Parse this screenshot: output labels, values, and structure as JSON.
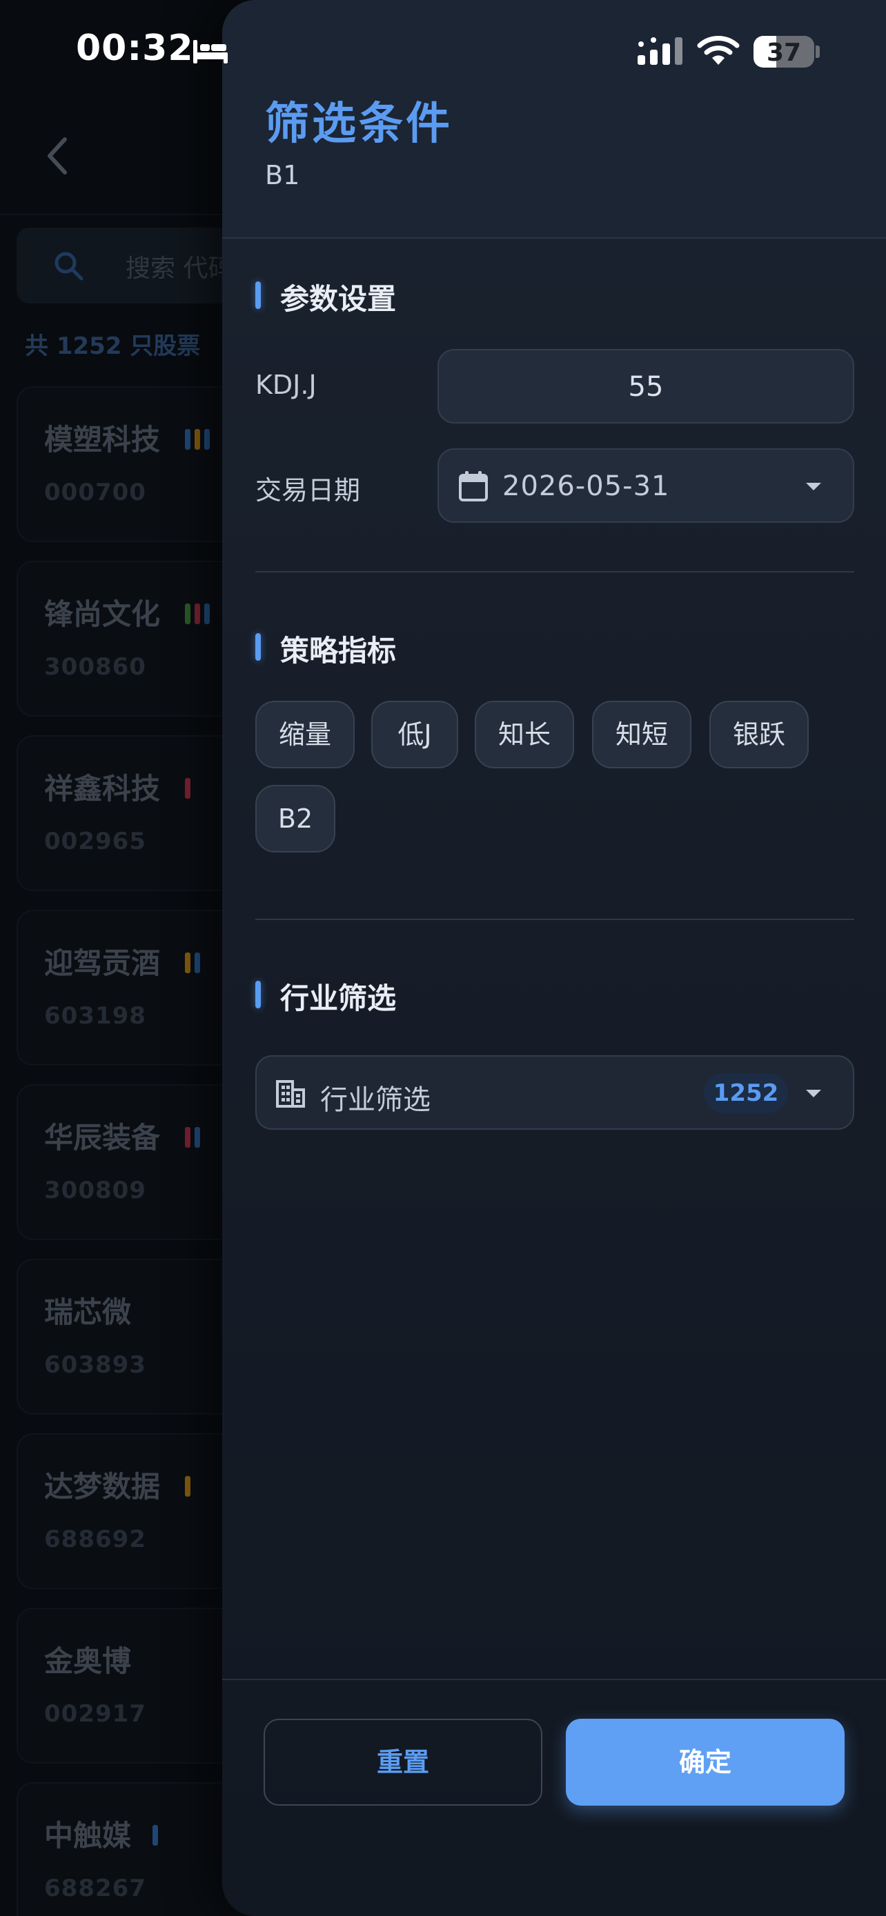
{
  "status_bar": {
    "time": "00:32",
    "battery_percent": "37",
    "battery_level": 0.37
  },
  "background": {
    "search_placeholder": "搜索 代码",
    "count_text": "共 1252 只股票",
    "stocks": [
      {
        "name": "模塑科技",
        "code": "000700",
        "tags": [
          "#2f6db5",
          "#c58a19",
          "#2f6db5"
        ]
      },
      {
        "name": "锋尚文化",
        "code": "300860",
        "tags": [
          "#3f8a3a",
          "#b5344a",
          "#2f6db5"
        ]
      },
      {
        "name": "祥鑫科技",
        "code": "002965",
        "tags": [
          "#b5344a"
        ]
      },
      {
        "name": "迎驾贡酒",
        "code": "603198",
        "tags": [
          "#c58a19",
          "#2f6db5"
        ]
      },
      {
        "name": "华辰装备",
        "code": "300809",
        "tags": [
          "#b5344a",
          "#2f6db5"
        ]
      },
      {
        "name": "瑞芯微",
        "code": "603893",
        "tags": []
      },
      {
        "name": "达梦数据",
        "code": "688692",
        "tags": [
          "#c58a19"
        ]
      },
      {
        "name": "金奥博",
        "code": "002917",
        "tags": []
      },
      {
        "name": "中触媒",
        "code": "688267",
        "tags": [
          "#2f6db5"
        ]
      }
    ]
  },
  "drawer": {
    "title": "筛选条件",
    "subtitle": "B1",
    "params_section": {
      "title": "参数设置",
      "kdj_label": "KDJ.J",
      "kdj_value": "55",
      "date_label": "交易日期",
      "date_value": "2026-05-31"
    },
    "strategy_section": {
      "title": "策略指标",
      "chips": [
        "缩量",
        "低J",
        "知长",
        "知短",
        "银跃",
        "B2"
      ]
    },
    "industry_section": {
      "title": "行业筛选",
      "select_label": "行业筛选",
      "count": "1252"
    },
    "buttons": {
      "reset": "重置",
      "confirm": "确定"
    }
  }
}
